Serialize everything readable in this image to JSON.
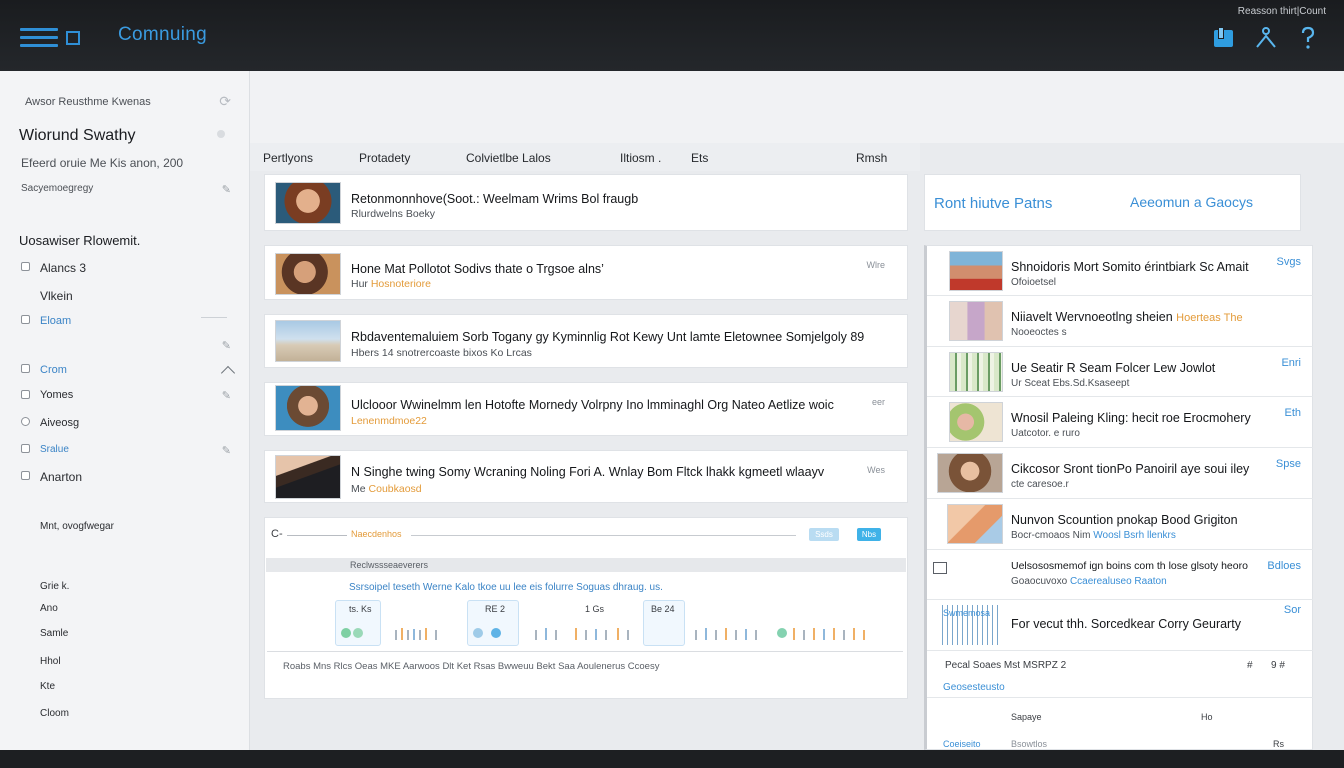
{
  "topbar": {
    "title": "Comnuing",
    "account": "Reasson thirt|Count",
    "icons": [
      "menu-icon",
      "window-icon",
      "bookmark-icon",
      "person-icon",
      "help-icon"
    ]
  },
  "sidebar": {
    "top_label": "Awsor Reusthme Kwenas",
    "heading": "Wiorund Swathy",
    "meta": "Efeerd oruie  Me Kis anon, 200",
    "link": "Sacyemoegregy",
    "section_title": "Uosawiser Rlowemit.",
    "items": [
      {
        "label": "Alancs 3",
        "checkbox": true
      },
      {
        "label": "Vlkein",
        "checkbox": false
      },
      {
        "label": "Eloam",
        "checkbox": true
      },
      {
        "label": "Crom",
        "checkbox": true
      },
      {
        "label": "Yomes",
        "checkbox": true
      },
      {
        "label": "Aiveosg",
        "checkbox": true
      },
      {
        "label": "Sralue",
        "checkbox": true
      },
      {
        "label": "Anarton",
        "checkbox": true
      }
    ],
    "group_label": "Mnt, ovogfwegar",
    "footer_items": [
      "Grie k.",
      "Ano",
      "Samle",
      "Hhol",
      "Kte",
      "Cloom"
    ]
  },
  "columns": [
    "Pertlyons",
    "Protadety",
    "Colvietlbe Lalos",
    "Iltiosm .",
    "Ets",
    "Rmsh"
  ],
  "rows": [
    {
      "title": "Retonmonnhove(Soot.:  Weelmam Wrims Bol fraugb",
      "sub": "Rlurdwelns Boeky",
      "sub_hl": "",
      "meta": "",
      "thumb": "woman-red"
    },
    {
      "title": "Hone Mat Pollotot Sodivs thate o Trgsoe alns’",
      "sub": "Hur",
      "sub_hl": "Hosnoteriore",
      "meta": "Wlre",
      "thumb": "man-mic"
    },
    {
      "title": "Rbdaventemaluiem Sorb Togany  gy  Kyminnlig Rot Kewy Unt lamte Eletownee Somjelgoly  89",
      "sub": "Hbers 14 snotrercoaste bixos Ko Lrcas",
      "sub_hl": "",
      "meta": "",
      "thumb": "landmark"
    },
    {
      "title": "Ulclooor Wwinelmm len Hotofte Mornedy Volrpny Ino lmminaghl Org Nateo Aetlize woic",
      "sub": "",
      "sub_hl": "Lenenmdmoe22",
      "meta": "eer",
      "thumb": "woman-brunette"
    },
    {
      "title": "N Singhe twing Somy Wcraning Noling Fori A.  Wnlay Bom Fltck lhakk kgmeetl wlaayv",
      "sub": "Me",
      "sub_hl": "Coubkaosd",
      "meta": "Wes",
      "thumb": "man-suit"
    }
  ],
  "panel": {
    "control": "C-",
    "tag": "Naecdenhos",
    "button1": "Ssds",
    "button2": "Nbs",
    "section": "Reclwssseaeverers",
    "caption": "Ssrsoipel teseth Werne Kalo tkoe uu lee eis folurre Soguas dhraug. us.",
    "footer": "Roabs Mns Rlcs Oeas  MKE Aarwoos Dlt Ket Rsas  Bwweuu Bekt Saa Aoulenerus Ccoesy",
    "viz_labels": [
      "ts. Ks",
      "RE 2",
      "1 Gs",
      "Be 24"
    ]
  },
  "right_panel": {
    "left_label": "Ront hiutve Patns",
    "right_label": "Aeeomun a   Gaocys",
    "items": [
      {
        "title": "Shnoidoris Mort Somito érintbiark Sc Amait",
        "sub": "Ofoioetsel",
        "sub_hl": "",
        "act": "Svgs",
        "thumb": "man-flag"
      },
      {
        "title": "Niiavelt Wervnoeotlng sheien",
        "sub": "Nooeoctes s",
        "sub_hl": "Hoerteas The",
        "act": "",
        "thumb": "women-group"
      },
      {
        "title": "Ue Seatir R Seam Folcer Lew Jowlot",
        "sub": "Ur Sceat Ebs.Sd.Ksaseept",
        "sub_hl": "",
        "act": "Enri",
        "thumb": "forest"
      },
      {
        "title": "Wnosil Paleing Kling: hecit roe Erocmohery",
        "sub": "Uatcotor. e ruro",
        "sub_hl": "",
        "act": "Eth",
        "thumb": "woman-flower"
      },
      {
        "title": "Cikcosor Sront tionPo Panoiril aye soui iley",
        "sub": "cte caresoe.r",
        "sub_hl": "",
        "act": "Spse",
        "thumb": "woman-curly"
      },
      {
        "title": "Nunvon Scountion  pnokap  Bood Grigiton",
        "sub": "Bocr-cmoaos  Nim",
        "sub_hl": "Woosl  Bsrh llenkrs",
        "act": "",
        "thumb": "fingers"
      },
      {
        "title": "Uelsososmemof ign boins com th lose glsoty heoro",
        "sub": "Goaocuvoxo",
        "sub_hl": "Ccaerealuseo Raaton",
        "act": "Bdloes",
        "thumb": "none"
      },
      {
        "title": "For vecut thh. Sorcedkear Corry Geurarty",
        "sub": "Swmemosa",
        "sub_hl": "",
        "act": "Sor",
        "thumb": "barcode"
      }
    ],
    "stats_row": [
      "Pecal Soaes Mst  MSRPZ 2",
      "#",
      "9 #",
      "⌘"
    ],
    "stats_label": "Geosesteusto",
    "totals": [
      "Sapaye",
      "Ho"
    ],
    "footer": [
      "Coeiseito",
      "Bsowtlos",
      "Rs"
    ]
  },
  "colors": {
    "accent": "#3a8fd6",
    "highlight": "#e39b3a",
    "topbar": "#1f2124"
  }
}
